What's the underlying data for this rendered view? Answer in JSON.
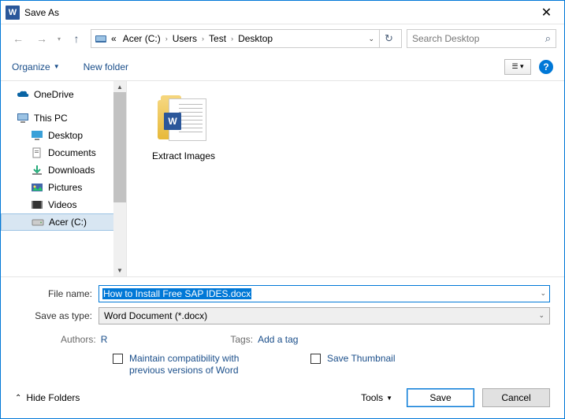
{
  "window": {
    "title": "Save As"
  },
  "nav": {
    "breadcrumb_prefix": "«",
    "crumbs": [
      "Acer (C:)",
      "Users",
      "Test",
      "Desktop"
    ],
    "search_placeholder": "Search Desktop"
  },
  "toolbar": {
    "organize": "Organize",
    "new_folder": "New folder"
  },
  "sidebar": {
    "items": [
      {
        "label": "OneDrive",
        "icon": "cloud",
        "indent": false,
        "selected": false
      },
      {
        "label": "This PC",
        "icon": "pc",
        "indent": false,
        "selected": false
      },
      {
        "label": "Desktop",
        "icon": "desktop",
        "indent": true,
        "selected": false
      },
      {
        "label": "Documents",
        "icon": "doc",
        "indent": true,
        "selected": false
      },
      {
        "label": "Downloads",
        "icon": "download",
        "indent": true,
        "selected": false
      },
      {
        "label": "Pictures",
        "icon": "pic",
        "indent": true,
        "selected": false
      },
      {
        "label": "Videos",
        "icon": "video",
        "indent": true,
        "selected": false
      },
      {
        "label": "Acer (C:)",
        "icon": "drive",
        "indent": true,
        "selected": true
      }
    ]
  },
  "content": {
    "items": [
      {
        "label": "Extract Images",
        "type": "folder-word"
      }
    ]
  },
  "form": {
    "filename_label": "File name:",
    "filename_value": "How to Install Free SAP IDES.docx",
    "type_label": "Save as type:",
    "type_value": "Word Document (*.docx)"
  },
  "meta": {
    "authors_label": "Authors:",
    "authors_value": "R",
    "tags_label": "Tags:",
    "tags_value": "Add a tag"
  },
  "checks": {
    "compat": "Maintain compatibility with previous versions of Word",
    "thumb": "Save Thumbnail"
  },
  "footer": {
    "hide_folders": "Hide Folders",
    "tools": "Tools",
    "save": "Save",
    "cancel": "Cancel"
  }
}
